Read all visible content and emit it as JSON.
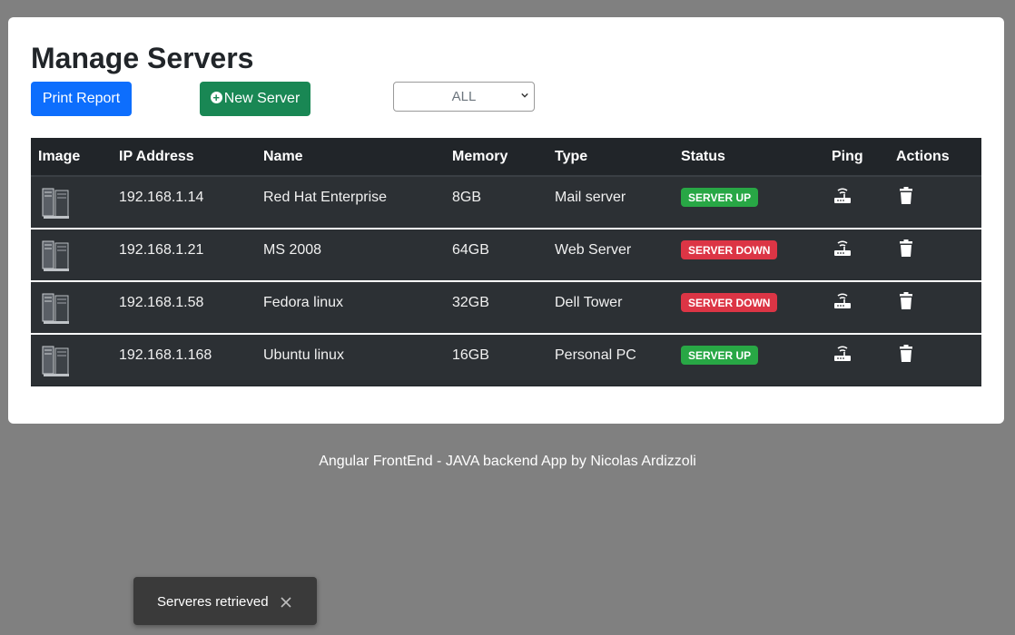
{
  "page": {
    "title": "Manage Servers"
  },
  "toolbar": {
    "print_label": "Print Report",
    "new_server_label": "New Server",
    "filter_value": "ALL",
    "filter_options": [
      "ALL"
    ]
  },
  "table": {
    "headers": [
      "Image",
      "IP Address",
      "Name",
      "Memory",
      "Type",
      "Status",
      "Ping",
      "Actions"
    ],
    "rows": [
      {
        "ip": "192.168.1.14",
        "name": "Red Hat Enterprise",
        "memory": "8GB",
        "type": "Mail server",
        "status": "SERVER UP",
        "status_kind": "up"
      },
      {
        "ip": "192.168.1.21",
        "name": "MS 2008",
        "memory": "64GB",
        "type": "Web Server",
        "status": "SERVER DOWN",
        "status_kind": "down"
      },
      {
        "ip": "192.168.1.58",
        "name": "Fedora linux",
        "memory": "32GB",
        "type": "Dell Tower",
        "status": "SERVER DOWN",
        "status_kind": "down"
      },
      {
        "ip": "192.168.1.168",
        "name": "Ubuntu linux",
        "memory": "16GB",
        "type": "Personal PC",
        "status": "SERVER UP",
        "status_kind": "up"
      }
    ]
  },
  "icons": {
    "ping": "router-wifi-icon",
    "delete": "trash-icon",
    "image": "server-tower-icon",
    "close": "close-icon"
  },
  "colors": {
    "primary": "#0d6efd",
    "success": "#198754",
    "status_up": "#28a745",
    "status_down": "#dc3545",
    "table_dark": "#212529"
  },
  "footer": {
    "text": "Angular FrontEnd - JAVA backend App by Nicolas Ardizzoli"
  },
  "toast": {
    "message": "Serveres retrieved"
  }
}
